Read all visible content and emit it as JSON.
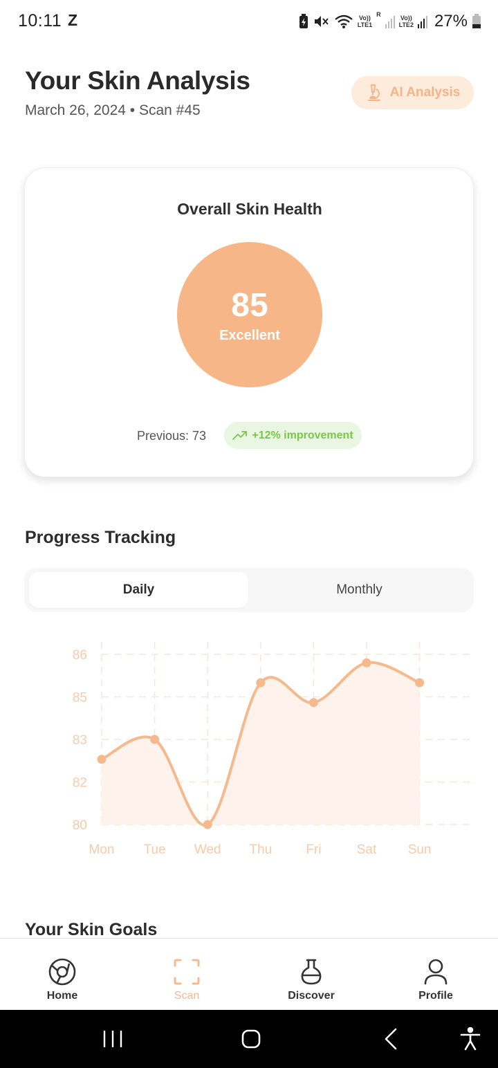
{
  "status_bar": {
    "time": "10:11",
    "notification_letter": "Z",
    "sim1_label": "Vo))",
    "sim1_sub": "LTE1",
    "roaming": "R",
    "sim2_label": "Vo))",
    "sim2_sub": "LTE2",
    "battery": "27%"
  },
  "header": {
    "title": "Your Skin Analysis",
    "subtitle": "March 26, 2024 • Scan #45",
    "ai_button_label": "AI Analysis",
    "ai_icon": "microscope-icon"
  },
  "health_card": {
    "title": "Overall Skin Health",
    "score": "85",
    "rating": "Excellent",
    "previous": "Previous: 73",
    "improvement": "+12% improvement",
    "improvement_icon": "trending-up-icon",
    "accent_color": "#f6b687",
    "improvement_color": "#7cc54b"
  },
  "progress": {
    "title": "Progress Tracking",
    "tabs": [
      {
        "label": "Daily",
        "active": true
      },
      {
        "label": "Monthly",
        "active": false
      }
    ]
  },
  "chart_data": {
    "type": "area",
    "categories": [
      "Mon",
      "Tue",
      "Wed",
      "Thu",
      "Fri",
      "Sat",
      "Sun"
    ],
    "series": [
      {
        "values": [
          82.3,
          83.0,
          80.0,
          85.0,
          84.3,
          85.7,
          85.0
        ]
      }
    ],
    "ytick_labels": [
      "86",
      "85",
      "83",
      "82",
      "80"
    ],
    "ytick_values": [
      86,
      85,
      83,
      82,
      80
    ],
    "ylim": [
      80,
      86
    ],
    "grid": true,
    "line_color": "#f5b98e",
    "fill_color": "#fdf3ec"
  },
  "goals": {
    "title": "Your Skin Goals"
  },
  "bottom_nav": {
    "items": [
      {
        "label": "Home",
        "icon": "home-icon",
        "active": false
      },
      {
        "label": "Scan",
        "icon": "scan-icon",
        "active": true
      },
      {
        "label": "Discover",
        "icon": "flask-icon",
        "active": false
      },
      {
        "label": "Profile",
        "icon": "profile-icon",
        "active": false
      }
    ]
  }
}
